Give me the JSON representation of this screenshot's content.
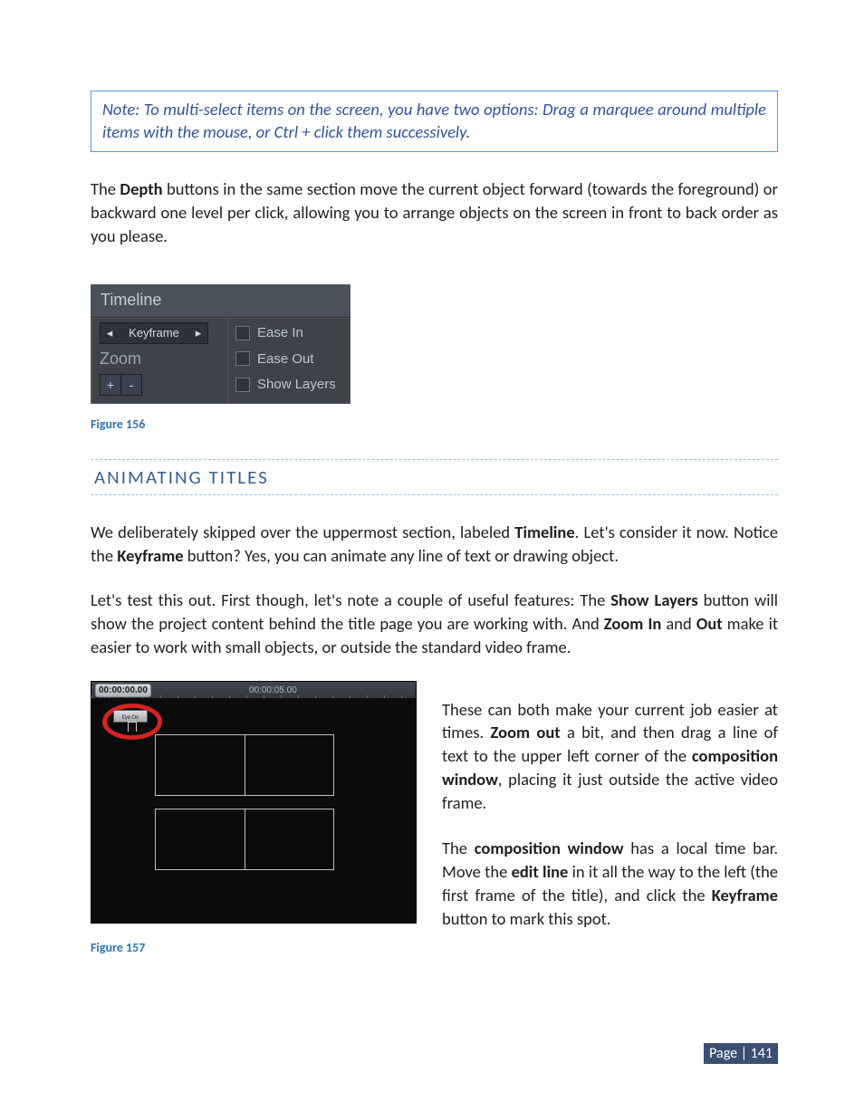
{
  "note": "Note: To multi-select items on the screen, you have two options: Drag a marquee around multiple items with the mouse, or Ctrl + click them successively.",
  "para_depth": {
    "pre": "The ",
    "b1": "Depth",
    "post": " buttons in the same section move the current object forward (towards the foreground) or backward one level per click, allowing you to arrange objects on the screen in front to back order as you please."
  },
  "panel156": {
    "title": "Timeline",
    "keyframe_label": "Keyframe",
    "zoom_label": "Zoom",
    "plus": "+",
    "minus": "-",
    "ease_in": "Ease In",
    "ease_out": "Ease Out",
    "show_layers": "Show Layers"
  },
  "fig156_caption": "Figure 156",
  "section_heading": "ANIMATING TITLES",
  "para_timeline": {
    "pre": "We deliberately skipped over the uppermost section, labeled ",
    "b1": "Timeline",
    "mid1": ".  Let's consider it now. Notice the ",
    "b2": "Keyframe",
    "post": " button? Yes, you can animate any line of text or drawing object."
  },
  "para_showlayers": {
    "pre": "Let's test this out. First though, let's note a couple of useful features: The ",
    "b1": "Show Layers",
    "mid1": " button will show the project content behind the title page you are working with.  And ",
    "b2": "Zoom In",
    "mid2": " and ",
    "b3": "Out",
    "post": " make it easier to work with small objects, or outside the standard video frame."
  },
  "fig157": {
    "tc_start": "00:00:00.00",
    "tc_mid": "00:00:05.00",
    "thumb_label": "Eye On"
  },
  "para_zoomout": {
    "pre": "These can both make your current job easier at times. ",
    "b1": "Zoom out",
    "mid1": " a bit, and then drag a line of text to the upper left corner of the ",
    "b2": "composition window",
    "post": ", placing it just outside the active video frame."
  },
  "para_editline": {
    "pre": "The ",
    "b1": "composition window",
    "mid1": " has a local time bar.  Move the ",
    "b2": "edit line",
    "mid2": " in it all the way to the left (the first frame of the title), and click the ",
    "b3": "Keyframe",
    "post": " button to mark this spot."
  },
  "fig157_caption": "Figure 157",
  "page_badge": "Page | 141"
}
